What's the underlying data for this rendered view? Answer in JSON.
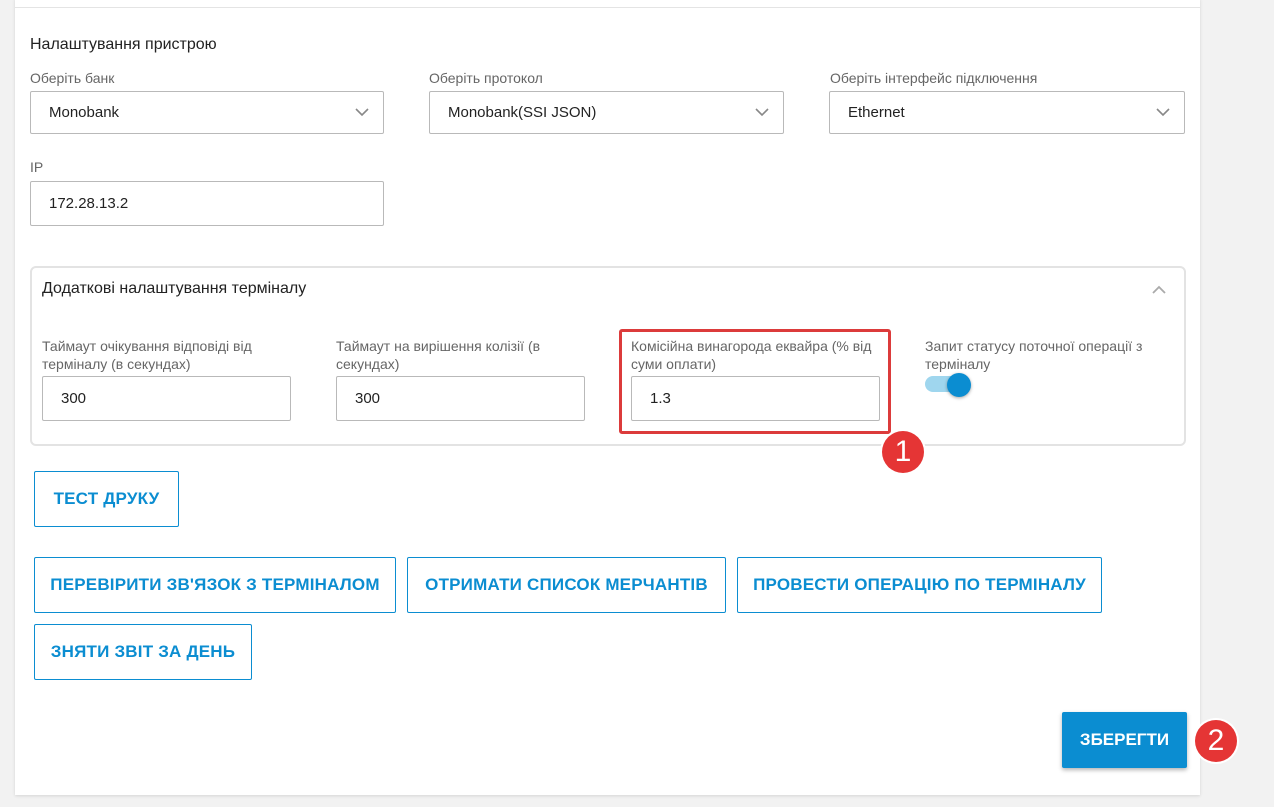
{
  "device_settings": {
    "title": "Налаштування пристрою",
    "bank": {
      "label": "Оберіть банк",
      "value": "Monobank"
    },
    "protocol": {
      "label": "Оберіть протокол",
      "value": "Monobank(SSI JSON)"
    },
    "interface": {
      "label": "Оберіть інтерфейс підключення",
      "value": "Ethernet"
    },
    "ip": {
      "label": "IP",
      "value": "172.28.13.2"
    }
  },
  "terminal_settings": {
    "title": "Додаткові налаштування терміналу",
    "response_timeout": {
      "label": "Таймаут очікування відповіді від терміналу (в секундах)",
      "value": "300"
    },
    "collision_timeout": {
      "label": "Таймаут на вирішення колізії (в секундах)",
      "value": "300"
    },
    "acquirer_fee": {
      "label": "Комісійна винагорода еквайра (% від суми оплати)",
      "value": "1.3"
    },
    "status_request": {
      "label": "Запит статусу поточної операції з терміналу",
      "enabled": true
    }
  },
  "buttons": {
    "test_print": "ТЕСТ ДРУКУ",
    "check_connection": "ПЕРЕВІРИТИ ЗВ'ЯЗОК З ТЕРМІНАЛОМ",
    "get_merchants": "ОТРИМАТИ СПИСОК МЕРЧАНТІВ",
    "run_operation": "ПРОВЕСТИ ОПЕРАЦІЮ ПО ТЕРМІНАЛУ",
    "daily_report": "ЗНЯТИ ЗВІТ ЗА ДЕНЬ",
    "save": "ЗБЕРЕГТИ"
  },
  "annotations": {
    "badge_1": "1",
    "badge_2": "2"
  },
  "colors": {
    "accent": "#0b8dd1",
    "highlight": "#dc3b3b",
    "badge": "#e53535"
  }
}
